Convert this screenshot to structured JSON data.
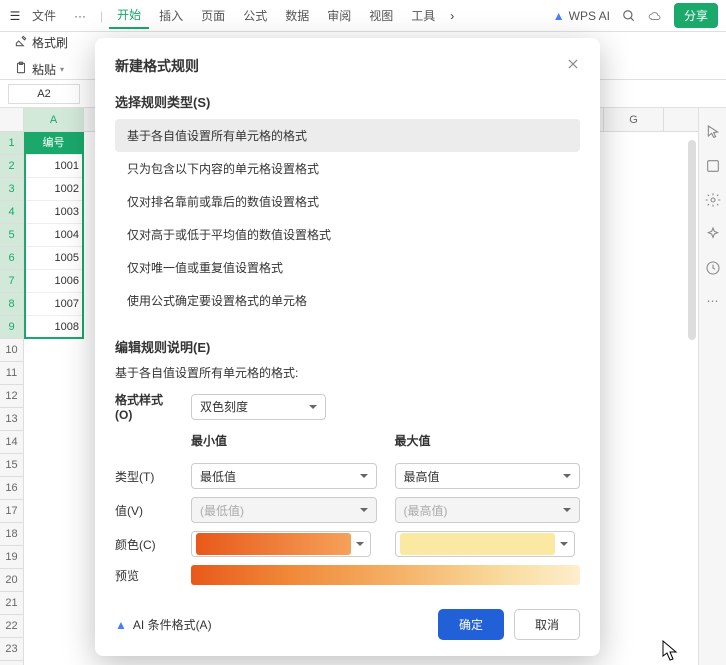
{
  "menubar": {
    "file": "文件",
    "items": [
      "开始",
      "插入",
      "页面",
      "公式",
      "数据",
      "审阅",
      "视图",
      "工具"
    ],
    "active": "开始",
    "wps_ai": "WPS AI",
    "share": "分享"
  },
  "toolbar": {
    "format_painter": "格式刷",
    "paste": "粘贴"
  },
  "cellref": "A2",
  "cols": [
    "A",
    "G"
  ],
  "rows": {
    "header": "编号",
    "values": [
      "1001",
      "1002",
      "1003",
      "1004",
      "1005",
      "1006",
      "1007",
      "1008"
    ]
  },
  "dialog": {
    "title": "新建格式规则",
    "section_select": "选择规则类型(S)",
    "rules": [
      "基于各自值设置所有单元格的格式",
      "只为包含以下内容的单元格设置格式",
      "仅对排名靠前或靠后的数值设置格式",
      "仅对高于或低于平均值的数值设置格式",
      "仅对唯一值或重复值设置格式",
      "使用公式确定要设置格式的单元格"
    ],
    "selected_rule": 0,
    "section_edit": "编辑规则说明(E)",
    "desc": "基于各自值设置所有单元格的格式:",
    "style_label": "格式样式(O)",
    "style_value": "双色刻度",
    "min_label": "最小值",
    "max_label": "最大值",
    "type_label": "类型(T)",
    "type_min": "最低值",
    "type_max": "最高值",
    "value_label": "值(V)",
    "value_min_placeholder": "(最低值)",
    "value_max_placeholder": "(最高值)",
    "color_label": "颜色(C)",
    "color_min": "#ec7627",
    "color_max": "#fbe9a3",
    "preview_label": "预览",
    "ai_link": "AI 条件格式(A)",
    "ok": "确定",
    "cancel": "取消"
  }
}
